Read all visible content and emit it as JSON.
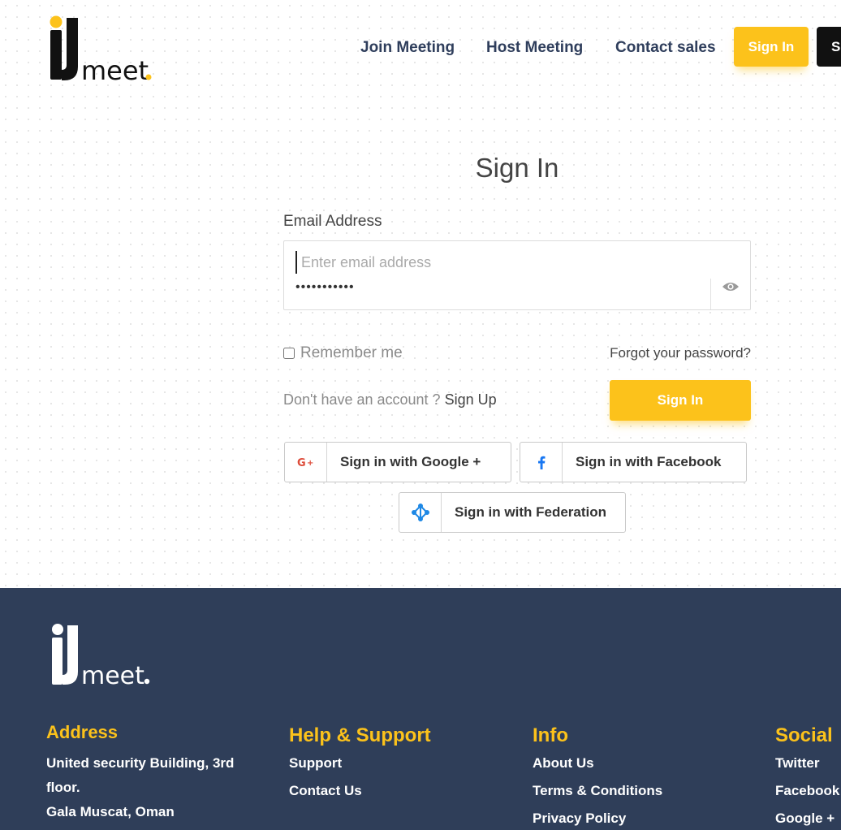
{
  "brand": {
    "logo_text": "iJmeet.",
    "accent_color": "#fcc21b",
    "footer_bg": "#2f3e59"
  },
  "header": {
    "nav": [
      {
        "label": "Join Meeting"
      },
      {
        "label": "Host Meeting"
      },
      {
        "label": "Contact sales"
      }
    ],
    "signin_label": "Sign In",
    "signup_label": "S"
  },
  "signin": {
    "title": "Sign In",
    "email_label": "Email Address",
    "email_placeholder": "Enter email address",
    "email_value": "",
    "password_value": "•••••••••••",
    "password_toggle_icon": "eye-icon",
    "remember_label": "Remember me",
    "remember_checked": false,
    "forgot_label": "Forgot your password?",
    "no_account_text": "Don't have an account ?",
    "signup_link": "Sign Up",
    "submit_label": "Sign In"
  },
  "social": {
    "google": {
      "label": "Sign in with Google +",
      "icon": "google-plus-icon",
      "color": "#dd4b39"
    },
    "facebook": {
      "label": "Sign in with Facebook",
      "icon": "facebook-icon",
      "color": "#1877f2"
    },
    "federation": {
      "label": "Sign in with Federation",
      "icon": "federation-icon",
      "color": "#1e88e5"
    }
  },
  "footer": {
    "address": {
      "title": "Address",
      "line1": "United security Building, 3rd",
      "line2": "floor.",
      "line3": "Gala Muscat, Oman"
    },
    "help": {
      "title": "Help & Support",
      "links": [
        "Support",
        "Contact Us"
      ]
    },
    "info": {
      "title": "Info",
      "links": [
        "About Us",
        "Terms & Conditions",
        "Privacy Policy"
      ]
    },
    "social": {
      "title": "Social",
      "links": [
        "Twitter",
        "Facebook",
        "Google +"
      ]
    }
  }
}
